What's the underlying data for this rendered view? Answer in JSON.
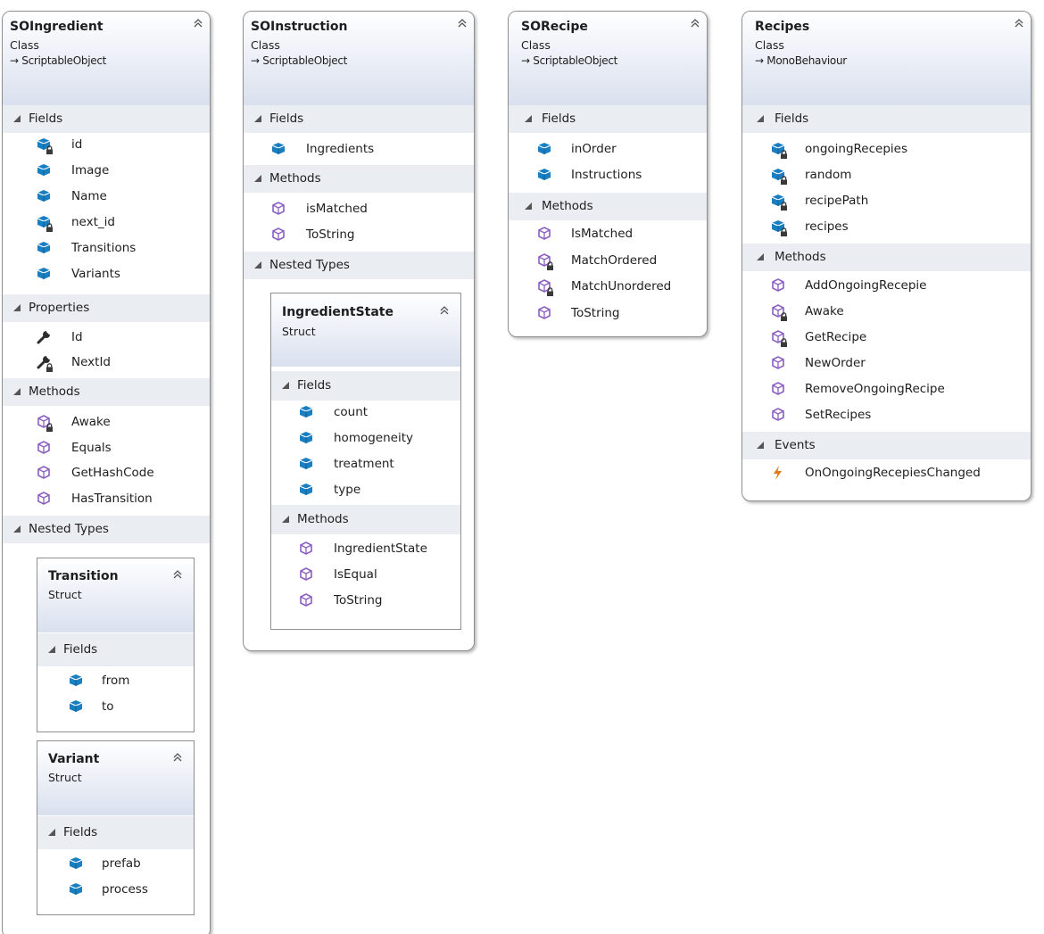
{
  "colors": {
    "field_icon": "#1a7fc1",
    "method_icon": "#8b5fc0",
    "property_icon": "#2d2d2d",
    "event_icon": "#e07a14",
    "lock_badge": "#3a3a3a",
    "header_gradient_bottom": "#d9e0ee",
    "section_band": "#eaedf2"
  },
  "classes": {
    "so_ingredient": {
      "name": "SOIngredient",
      "kind": "Class",
      "base": "→ ScriptableObject",
      "fields_label": "Fields",
      "fields": [
        {
          "name": "id",
          "icon": "field-private-icon"
        },
        {
          "name": "Image",
          "icon": "field-icon"
        },
        {
          "name": "Name",
          "icon": "field-icon"
        },
        {
          "name": "next_id",
          "icon": "field-private-icon"
        },
        {
          "name": "Transitions",
          "icon": "field-icon"
        },
        {
          "name": "Variants",
          "icon": "field-icon"
        }
      ],
      "properties_label": "Properties",
      "properties": [
        {
          "name": "Id",
          "icon": "property-icon"
        },
        {
          "name": "NextId",
          "icon": "property-private-icon"
        }
      ],
      "methods_label": "Methods",
      "methods": [
        {
          "name": "Awake",
          "icon": "method-private-icon"
        },
        {
          "name": "Equals",
          "icon": "method-icon"
        },
        {
          "name": "GetHashCode",
          "icon": "method-icon"
        },
        {
          "name": "HasTransition",
          "icon": "method-icon"
        }
      ],
      "nested_label": "Nested Types",
      "transition": {
        "name": "Transition",
        "kind": "Struct",
        "fields_label": "Fields",
        "fields": [
          {
            "name": "from",
            "icon": "field-icon"
          },
          {
            "name": "to",
            "icon": "field-icon"
          }
        ]
      },
      "variant": {
        "name": "Variant",
        "kind": "Struct",
        "fields_label": "Fields",
        "fields": [
          {
            "name": "prefab",
            "icon": "field-icon"
          },
          {
            "name": "process",
            "icon": "field-icon"
          }
        ]
      }
    },
    "so_instruction": {
      "name": "SOInstruction",
      "kind": "Class",
      "base": "→ ScriptableObject",
      "fields_label": "Fields",
      "fields": [
        {
          "name": "Ingredients",
          "icon": "field-icon"
        }
      ],
      "methods_label": "Methods",
      "methods": [
        {
          "name": "isMatched",
          "icon": "method-icon"
        },
        {
          "name": "ToString",
          "icon": "method-icon"
        }
      ],
      "nested_label": "Nested Types",
      "ingredient_state": {
        "name": "IngredientState",
        "kind": "Struct",
        "fields_label": "Fields",
        "fields": [
          {
            "name": "count",
            "icon": "field-icon"
          },
          {
            "name": "homogeneity",
            "icon": "field-icon"
          },
          {
            "name": "treatment",
            "icon": "field-icon"
          },
          {
            "name": "type",
            "icon": "field-icon"
          }
        ],
        "methods_label": "Methods",
        "methods": [
          {
            "name": "IngredientState",
            "icon": "method-icon"
          },
          {
            "name": "IsEqual",
            "icon": "method-icon"
          },
          {
            "name": "ToString",
            "icon": "method-icon"
          }
        ]
      }
    },
    "so_recipe": {
      "name": "SORecipe",
      "kind": "Class",
      "base": "→ ScriptableObject",
      "fields_label": "Fields",
      "fields": [
        {
          "name": "inOrder",
          "icon": "field-icon"
        },
        {
          "name": "Instructions",
          "icon": "field-icon"
        }
      ],
      "methods_label": "Methods",
      "methods": [
        {
          "name": "IsMatched",
          "icon": "method-icon"
        },
        {
          "name": "MatchOrdered",
          "icon": "method-private-icon"
        },
        {
          "name": "MatchUnordered",
          "icon": "method-private-icon"
        },
        {
          "name": "ToString",
          "icon": "method-icon"
        }
      ]
    },
    "recipes": {
      "name": "Recipes",
      "kind": "Class",
      "base": "→ MonoBehaviour",
      "fields_label": "Fields",
      "fields": [
        {
          "name": "ongoingRecepies",
          "icon": "field-private-icon"
        },
        {
          "name": "random",
          "icon": "field-private-icon"
        },
        {
          "name": "recipePath",
          "icon": "field-private-icon"
        },
        {
          "name": "recipes",
          "icon": "field-private-icon"
        }
      ],
      "methods_label": "Methods",
      "methods": [
        {
          "name": "AddOngoingRecepie",
          "icon": "method-icon"
        },
        {
          "name": "Awake",
          "icon": "method-private-icon"
        },
        {
          "name": "GetRecipe",
          "icon": "method-private-icon"
        },
        {
          "name": "NewOrder",
          "icon": "method-icon"
        },
        {
          "name": "RemoveOngoingRecipe",
          "icon": "method-icon"
        },
        {
          "name": "SetRecipes",
          "icon": "method-icon"
        }
      ],
      "events_label": "Events",
      "events": [
        {
          "name": "OnOngoingRecepiesChanged",
          "icon": "event-icon"
        }
      ]
    }
  }
}
